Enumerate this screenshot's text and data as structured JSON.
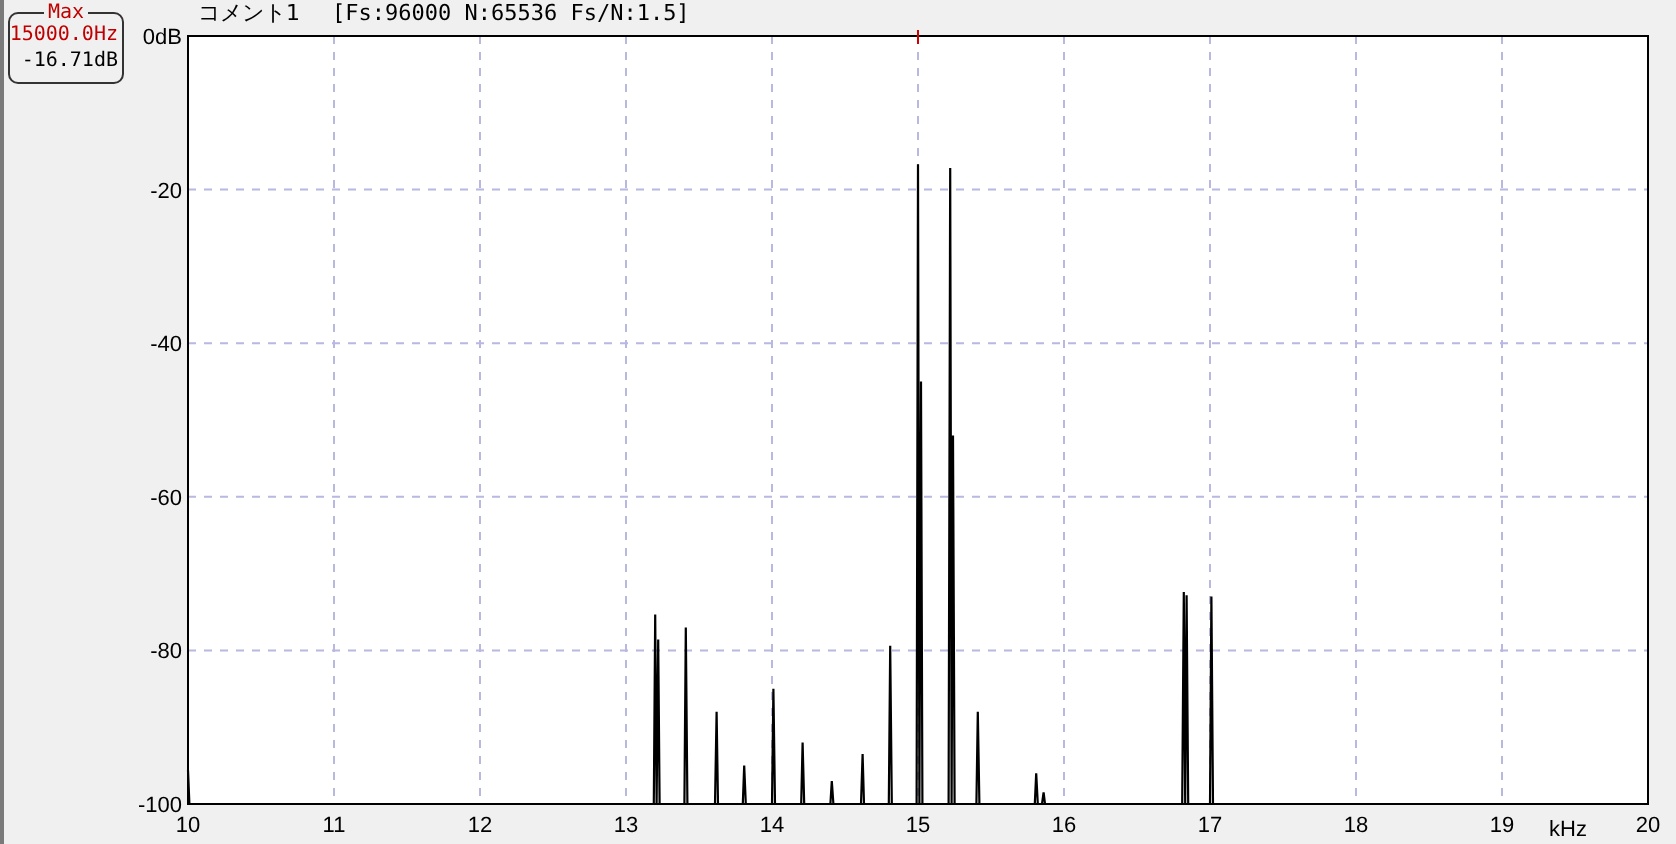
{
  "max_readout": {
    "label": "Max",
    "frequency": "15000.0Hz",
    "level": "-16.71dB"
  },
  "header": {
    "comment": "コメント1",
    "params": "[Fs:96000 N:65536 Fs/N:1.5]"
  },
  "chart_data": {
    "type": "line",
    "xlabel": "kHz",
    "xlim": [
      10,
      20
    ],
    "ylim": [
      -100,
      0
    ],
    "grid": true,
    "xticks": [
      10,
      11,
      12,
      13,
      14,
      15,
      16,
      17,
      18,
      19,
      20
    ],
    "yticks": [
      {
        "value": 0,
        "label": "0dB"
      },
      -20,
      -40,
      -60,
      -80,
      -100
    ],
    "x": [
      10.0,
      10.01,
      13.19,
      13.2,
      13.21,
      13.22,
      13.23,
      13.4,
      13.41,
      13.42,
      13.61,
      13.62,
      13.63,
      13.8,
      13.81,
      13.82,
      14.0,
      14.01,
      14.02,
      14.2,
      14.21,
      14.22,
      14.4,
      14.41,
      14.42,
      14.61,
      14.62,
      14.63,
      14.8,
      14.81,
      14.82,
      14.99,
      15.0,
      15.01,
      15.02,
      15.03,
      15.21,
      15.22,
      15.23,
      15.24,
      15.25,
      15.4,
      15.41,
      15.42,
      15.8,
      15.81,
      15.82,
      15.85,
      15.86,
      15.87,
      16.81,
      16.82,
      16.83,
      16.84,
      16.85,
      17.0,
      17.01,
      17.02
    ],
    "series": [
      {
        "color": "#000000",
        "values": [
          -95.6,
          -100,
          -100,
          -75.3,
          -100,
          -78.6,
          -100,
          -100,
          -77,
          -100,
          -100,
          -88,
          -100,
          -100,
          -95,
          -100,
          -100,
          -85,
          -100,
          -100,
          -92,
          -100,
          -100,
          -97,
          -100,
          -100,
          -93.5,
          -100,
          -100,
          -79.4,
          -100,
          -100,
          -16.7,
          -100,
          -45,
          -100,
          -100,
          -17.2,
          -100,
          -52,
          -100,
          -100,
          -88,
          -100,
          -100,
          -96,
          -100,
          -100,
          -98.5,
          -100,
          -100,
          -72.4,
          -100,
          -72.8,
          -100,
          -100,
          -73,
          -100
        ]
      }
    ]
  }
}
